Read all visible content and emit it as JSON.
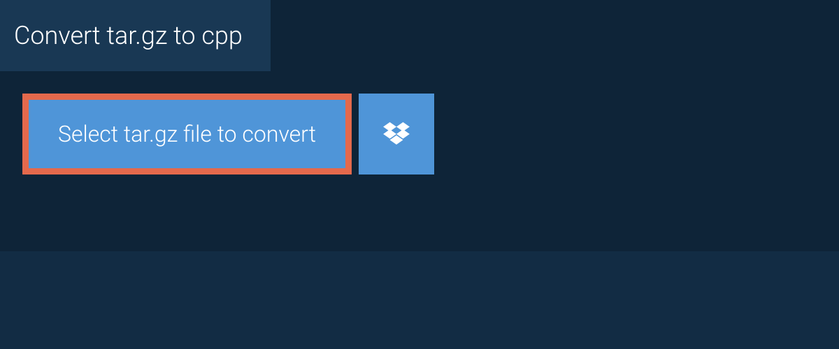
{
  "tab": {
    "title": "Convert tar.gz to cpp"
  },
  "main": {
    "select_button_label": "Select tar.gz file to convert",
    "dropbox_icon": "dropbox-icon"
  },
  "colors": {
    "page_bg": "#122c44",
    "container_bg": "#0e2438",
    "tab_bg": "#193854",
    "button_bg": "#4f95d8",
    "button_border": "#e4694c",
    "text": "#ffffff"
  }
}
